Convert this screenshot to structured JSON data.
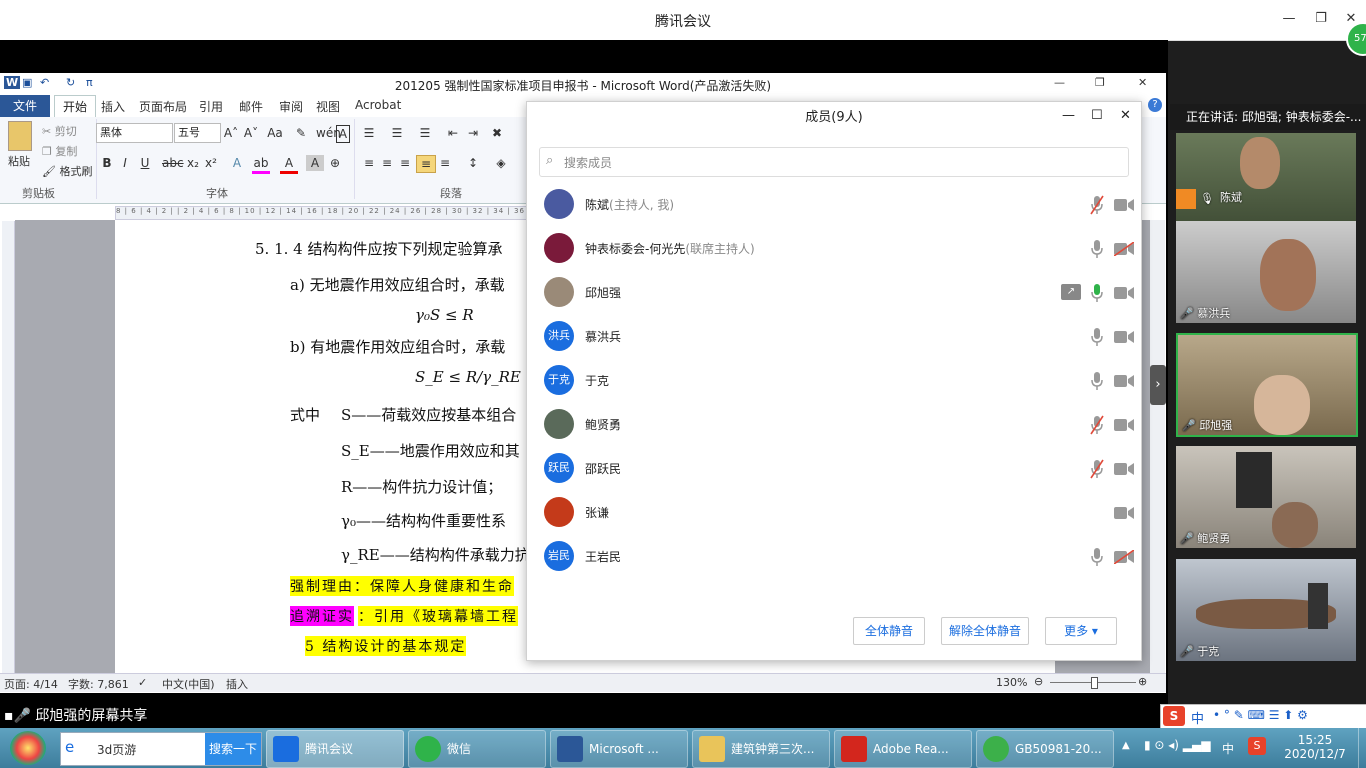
{
  "meeting": {
    "title": "腾讯会议",
    "net_badge": "57",
    "speaking": "正在讲话: 邱旭强; 钟表标委会-...",
    "share_notice": "邱旭强的屏幕共享"
  },
  "word": {
    "title": "201205 强制性国家标准项目申报书 - Microsoft Word(产品激活失败)",
    "tabs": [
      "文件",
      "开始",
      "插入",
      "页面布局",
      "引用",
      "邮件",
      "审阅",
      "视图",
      "Acrobat"
    ],
    "clipboard": {
      "paste": "粘贴",
      "cut": "剪切",
      "copy": "复制",
      "format_painter": "格式刷",
      "label": "剪贴板"
    },
    "font": {
      "name": "黑体",
      "size": "五号",
      "label": "字体"
    },
    "paragraph_label": "段落",
    "doc_lines": {
      "l1": "5. 1. 4  结构构件应按下列规定验算承",
      "l2": "a)  无地震作用效应组合时，承载",
      "l3": "γ₀S  ≤  R",
      "l4": "b)  有地震作用效应组合时，承载",
      "l5": "S_E  ≤  R/γ_RE",
      "l6a": "式中",
      "l6b": "S——荷载效应按基本组合",
      "l7": "S_E——地震作用效应和其",
      "l8": "R——构件抗力设计值；",
      "l9": "γ₀——结构构件重要性系",
      "l10": "γ_RE——结构构件承载力抗",
      "l11": "强制理由：保障人身健康和生命",
      "l12a": "追溯证实",
      "l12b": "：引用《玻璃幕墙工程",
      "l13": "5 结构设计的基本规定"
    },
    "status": {
      "page": "页面: 4/14",
      "words": "字数: 7,861",
      "lang": "中文(中国)",
      "mode": "插入",
      "zoom": "130%"
    }
  },
  "members": {
    "title": "成员(9人)",
    "search_placeholder": "搜索成员",
    "list": [
      {
        "name": "陈斌",
        "role": "(主持人, 我)",
        "avatar": "",
        "mic": "muted",
        "cam": "on"
      },
      {
        "name": "钟表标委会-何光先",
        "role": "(联席主持人)",
        "avatar": "",
        "mic": "on",
        "cam": "off"
      },
      {
        "name": "邱旭强",
        "role": "",
        "avatar": "",
        "mic": "speaking",
        "cam": "on",
        "sharing": true
      },
      {
        "name": "慕洪兵",
        "role": "",
        "avatar": "洪兵",
        "mic": "on",
        "cam": "on"
      },
      {
        "name": "于克",
        "role": "",
        "avatar": "于克",
        "mic": "on",
        "cam": "on"
      },
      {
        "name": "鲍贤勇",
        "role": "",
        "avatar": "",
        "mic": "muted",
        "cam": "on"
      },
      {
        "name": "邵跃民",
        "role": "",
        "avatar": "跃民",
        "mic": "muted",
        "cam": "on"
      },
      {
        "name": "张谦",
        "role": "",
        "avatar": "",
        "mic": "none",
        "cam": "on"
      },
      {
        "name": "王岩民",
        "role": "",
        "avatar": "岩民",
        "mic": "on",
        "cam": "off"
      }
    ],
    "buttons": {
      "mute_all": "全体静音",
      "unmute_all": "解除全体静音",
      "more": "更多 ▾"
    }
  },
  "videos": [
    {
      "name": "陈斌"
    },
    {
      "name": "慕洪兵"
    },
    {
      "name": "邱旭强"
    },
    {
      "name": "鲍贤勇"
    },
    {
      "name": "于克"
    }
  ],
  "taskbar": {
    "search_text": "3d页游",
    "search_btn": "搜索一下",
    "items": [
      "腾讯会议",
      "微信",
      "Microsoft ...",
      "建筑钟第三次...",
      "Adobe Rea...",
      "GB50981-20..."
    ],
    "ime": "中",
    "time": "15:25",
    "date": "2020/12/7"
  }
}
